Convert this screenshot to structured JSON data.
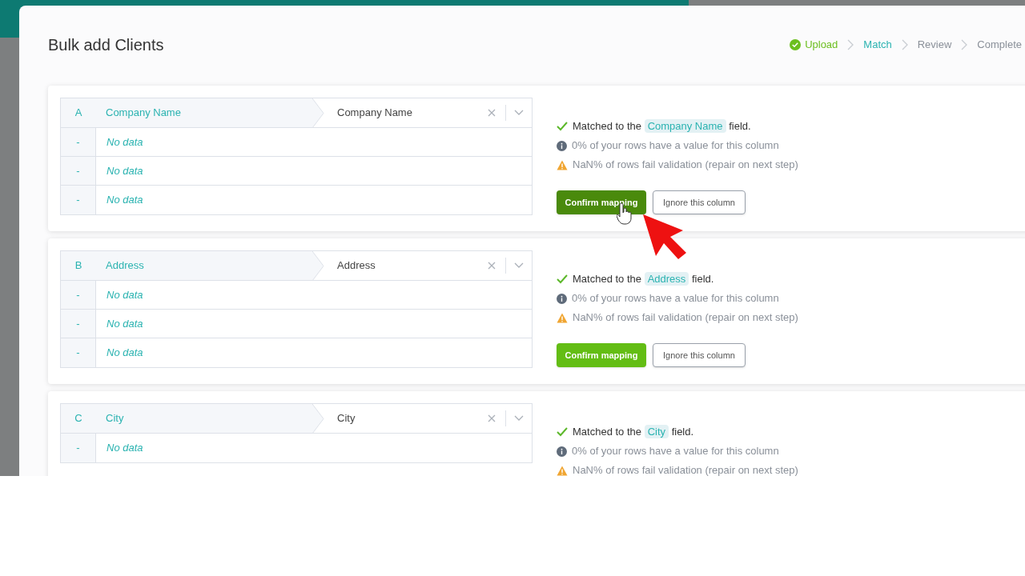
{
  "dialog": {
    "title": "Bulk add Clients"
  },
  "steps": [
    {
      "label": "Upload",
      "done": true,
      "selected": false
    },
    {
      "label": "Match",
      "done": false,
      "selected": true
    },
    {
      "label": "Review",
      "done": false,
      "selected": false
    },
    {
      "label": "Complete",
      "done": false,
      "selected": false
    }
  ],
  "columns": [
    {
      "letter": "A",
      "header": "Company Name",
      "match": "Company Name",
      "rows": [
        {
          "marker": "-",
          "value": "No data"
        },
        {
          "marker": "-",
          "value": "No data"
        },
        {
          "marker": "-",
          "value": "No data"
        }
      ],
      "matched_prefix": "Matched to the",
      "matched_field": "Company Name",
      "matched_suffix": "field.",
      "info": "0% of your rows have a value for this column",
      "warning": "NaN% of rows fail validation (repair on next step)",
      "confirm": {
        "label": "Confirm mapping",
        "hovered": true
      },
      "ignore": "Ignore this column"
    },
    {
      "letter": "B",
      "header": "Address",
      "match": "Address",
      "rows": [
        {
          "marker": "-",
          "value": "No data"
        },
        {
          "marker": "-",
          "value": "No data"
        },
        {
          "marker": "-",
          "value": "No data"
        }
      ],
      "matched_prefix": "Matched to the",
      "matched_field": "Address",
      "matched_suffix": "field.",
      "info": "0% of your rows have a value for this column",
      "warning": "NaN% of rows fail validation (repair on next step)",
      "confirm": {
        "label": "Confirm mapping",
        "hovered": false
      },
      "ignore": "Ignore this column"
    },
    {
      "letter": "C",
      "header": "City",
      "match": "City",
      "rows": [
        {
          "marker": "-",
          "value": "No data"
        }
      ],
      "matched_prefix": "Matched to the",
      "matched_field": "City",
      "matched_suffix": "field.",
      "info": "0% of your rows have a value for this column",
      "warning": "NaN% of rows fail validation (repair on next step)"
    }
  ]
}
